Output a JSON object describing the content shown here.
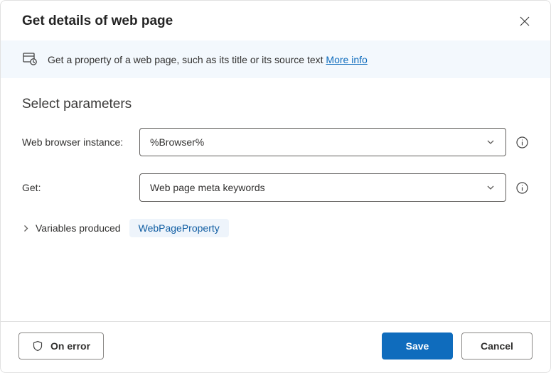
{
  "dialog": {
    "title": "Get details of web page"
  },
  "infoBar": {
    "text": "Get a property of a web page, such as its title or its source text ",
    "linkText": "More info"
  },
  "section": {
    "title": "Select parameters"
  },
  "fields": {
    "browser": {
      "label": "Web browser instance:",
      "value": "%Browser%"
    },
    "get": {
      "label": "Get:",
      "value": "Web page meta keywords"
    }
  },
  "variables": {
    "label": "Variables produced",
    "chip": "WebPageProperty"
  },
  "footer": {
    "onError": "On error",
    "save": "Save",
    "cancel": "Cancel"
  }
}
